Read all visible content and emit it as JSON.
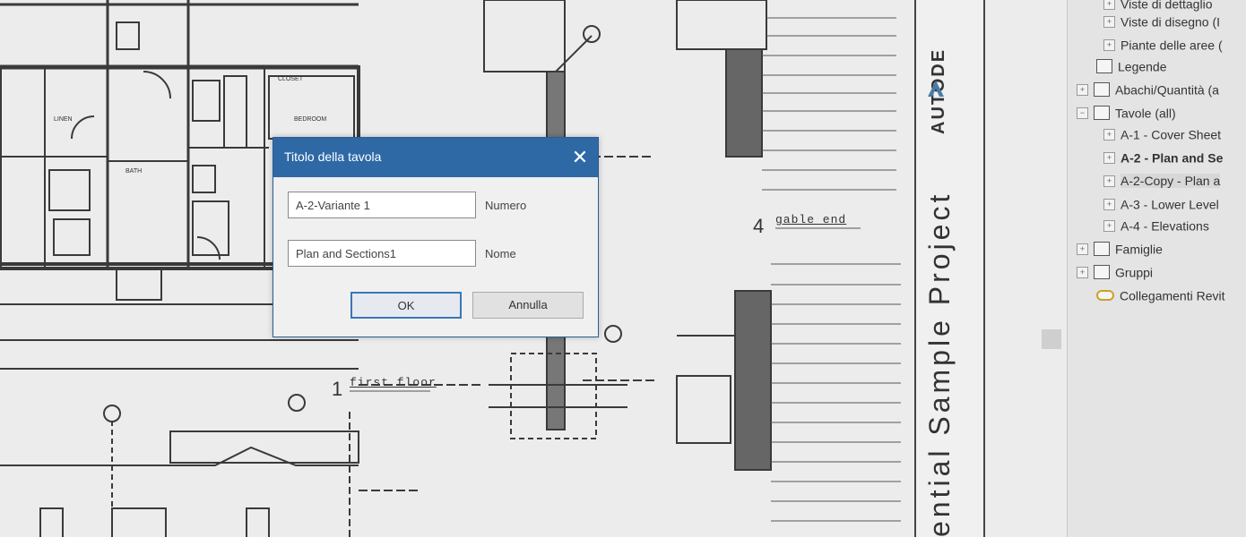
{
  "drawing": {
    "view_1_number": "1",
    "view_1_name": "first floor",
    "view_4_number": "4",
    "view_4_name": "gable end",
    "room_labels": [
      "CLOSET",
      "BEDROOM",
      "BATH",
      "LINEN"
    ]
  },
  "title_block": {
    "project_title": "ential Sample Project",
    "brand": "AUTODE"
  },
  "dialog": {
    "title": "Titolo della tavola",
    "close_glyph": "✕",
    "number_value": "A-2-Variante 1",
    "number_label": "Numero",
    "name_value": "Plan and Sections1",
    "name_label": "Nome",
    "ok_label": "OK",
    "cancel_label": "Annulla"
  },
  "project_browser": {
    "items": [
      {
        "label": "Viste di dettaglio",
        "expander": "+",
        "icon": "none"
      },
      {
        "label": "Viste di disegno (I",
        "expander": "+",
        "icon": "none"
      },
      {
        "label": "Piante delle aree (",
        "expander": "+",
        "icon": "none"
      },
      {
        "label": "Legende",
        "expander": "",
        "icon": "legend-icon"
      },
      {
        "label": "Abachi/Quantità (a",
        "expander": "+",
        "icon": "schedule-icon"
      },
      {
        "label": "Tavole (all)",
        "expander": "−",
        "icon": "sheets-icon"
      },
      {
        "label": "A-1 - Cover Sheet",
        "expander": "+",
        "icon": "none"
      },
      {
        "label": "A-2 - Plan and Se",
        "expander": "+",
        "icon": "none"
      },
      {
        "label": "A-2-Copy - Plan a",
        "expander": "+",
        "icon": "none"
      },
      {
        "label": "A-3 - Lower Level",
        "expander": "+",
        "icon": "none"
      },
      {
        "label": "A-4 - Elevations",
        "expander": "+",
        "icon": "none"
      },
      {
        "label": "Famiglie",
        "expander": "+",
        "icon": "families-icon"
      },
      {
        "label": "Gruppi",
        "expander": "+",
        "icon": "groups-icon"
      },
      {
        "label": "Collegamenti Revit",
        "expander": "",
        "icon": "links-icon"
      }
    ]
  }
}
